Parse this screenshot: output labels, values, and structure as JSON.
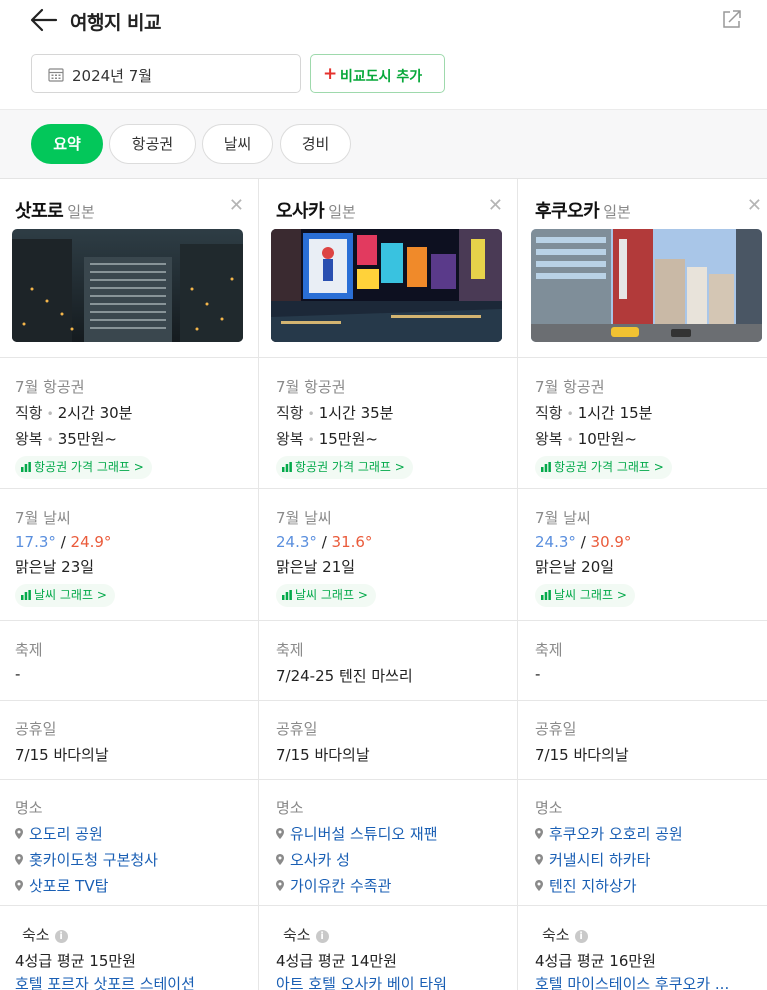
{
  "header": {
    "title": "여행지 비교"
  },
  "date_value": "2024년 7월",
  "add_button_plus": "+",
  "add_button_label": "비교도시 추가",
  "tabs": [
    {
      "label": "요약",
      "active": true
    },
    {
      "label": "항공권",
      "active": false
    },
    {
      "label": "날씨",
      "active": false
    },
    {
      "label": "경비",
      "active": false
    }
  ],
  "close_glyph": "✕",
  "temp_sep": "/",
  "info_glyph": "i",
  "cities": [
    {
      "name": "삿포로",
      "country": "일본",
      "flight": {
        "label": "7월 항공권",
        "direct_key": "직항",
        "direct": "2시간 30분",
        "round_key": "왕복",
        "round": "35만원~",
        "graph": "항공권 가격 그래프 >"
      },
      "weather": {
        "label": "7월 날씨",
        "low": "17.3°",
        "high": "24.9°",
        "clear": "맑은날 23일",
        "graph": "날씨 그래프 >"
      },
      "festival": {
        "label": "축제",
        "value": "-"
      },
      "holiday": {
        "label": "공휴일",
        "value": "7/15 바다의날"
      },
      "sights": {
        "label": "명소",
        "items": [
          "오도리 공원",
          "홋카이도청 구본청사",
          "삿포로 TV탑"
        ]
      },
      "stay": {
        "label": "숙소",
        "avg": "4성급 평균 15만원",
        "hotel": "호텔 포르자 삿포르 스테이션"
      }
    },
    {
      "name": "오사카",
      "country": "일본",
      "flight": {
        "label": "7월 항공권",
        "direct_key": "직항",
        "direct": "1시간 35분",
        "round_key": "왕복",
        "round": "15만원~",
        "graph": "항공권 가격 그래프 >"
      },
      "weather": {
        "label": "7월 날씨",
        "low": "24.3°",
        "high": "31.6°",
        "clear": "맑은날 21일",
        "graph": "날씨 그래프 >"
      },
      "festival": {
        "label": "축제",
        "value": "7/24-25 텐진 마쓰리"
      },
      "holiday": {
        "label": "공휴일",
        "value": "7/15 바다의날"
      },
      "sights": {
        "label": "명소",
        "items": [
          "유니버설 스튜디오 재팬",
          "오사카 성",
          "가이유칸 수족관"
        ]
      },
      "stay": {
        "label": "숙소",
        "avg": "4성급 평균 14만원",
        "hotel": "아트 호텔 오사카 베이 타워"
      }
    },
    {
      "name": "후쿠오카",
      "country": "일본",
      "flight": {
        "label": "7월 항공권",
        "direct_key": "직항",
        "direct": "1시간 15분",
        "round_key": "왕복",
        "round": "10만원~",
        "graph": "항공권 가격 그래프 >"
      },
      "weather": {
        "label": "7월 날씨",
        "low": "24.3°",
        "high": "30.9°",
        "clear": "맑은날 20일",
        "graph": "날씨 그래프 >"
      },
      "festival": {
        "label": "축제",
        "value": "-"
      },
      "holiday": {
        "label": "공휴일",
        "value": "7/15 바다의날"
      },
      "sights": {
        "label": "명소",
        "items": [
          "후쿠오카 오호리 공원",
          "커낼시티 하카타",
          "텐진 지하상가"
        ]
      },
      "stay": {
        "label": "숙소",
        "avg": "4성급 평균 16만원",
        "hotel": "호텔 마이스테이스 후쿠오카 ..."
      }
    }
  ],
  "colors": {
    "accent": "#03c75a",
    "cold": "#5a8fde",
    "hot": "#ea5b3b",
    "link": "#1a5fb4",
    "plus": "#e5322d"
  }
}
